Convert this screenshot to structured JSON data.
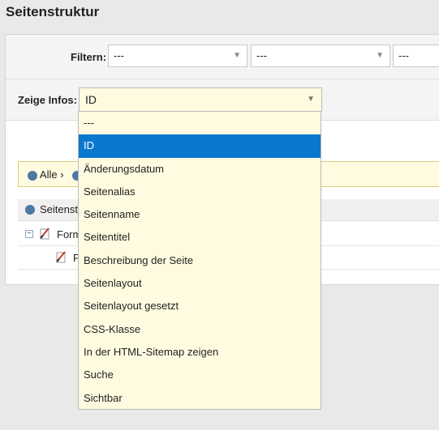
{
  "page": {
    "title": "Seitenstruktur"
  },
  "filter": {
    "label": "Filtern:",
    "selects": [
      "---",
      "---",
      "---"
    ]
  },
  "info": {
    "label": "Zeige Infos:",
    "selected": "ID",
    "options": [
      "---",
      "ID",
      "Änderungsdatum",
      "Seitenalias",
      "Seitenname",
      "Seitentitel",
      "Beschreibung der Seite",
      "Seitenlayout",
      "Seitenlayout gesetzt",
      "CSS-Klasse",
      "In der HTML-Sitemap zeigen",
      "Suche",
      "Sichtbar"
    ],
    "selected_index": 1
  },
  "breadcrumb": {
    "all": "Alle ›"
  },
  "tree": {
    "header": "Seitenst",
    "rows": [
      {
        "label": "Form"
      },
      {
        "label": "F"
      }
    ]
  },
  "colors": {
    "accent": "#0b78d0",
    "dropdown_bg": "#fffbe0",
    "node_icon": "#4e77a6"
  }
}
